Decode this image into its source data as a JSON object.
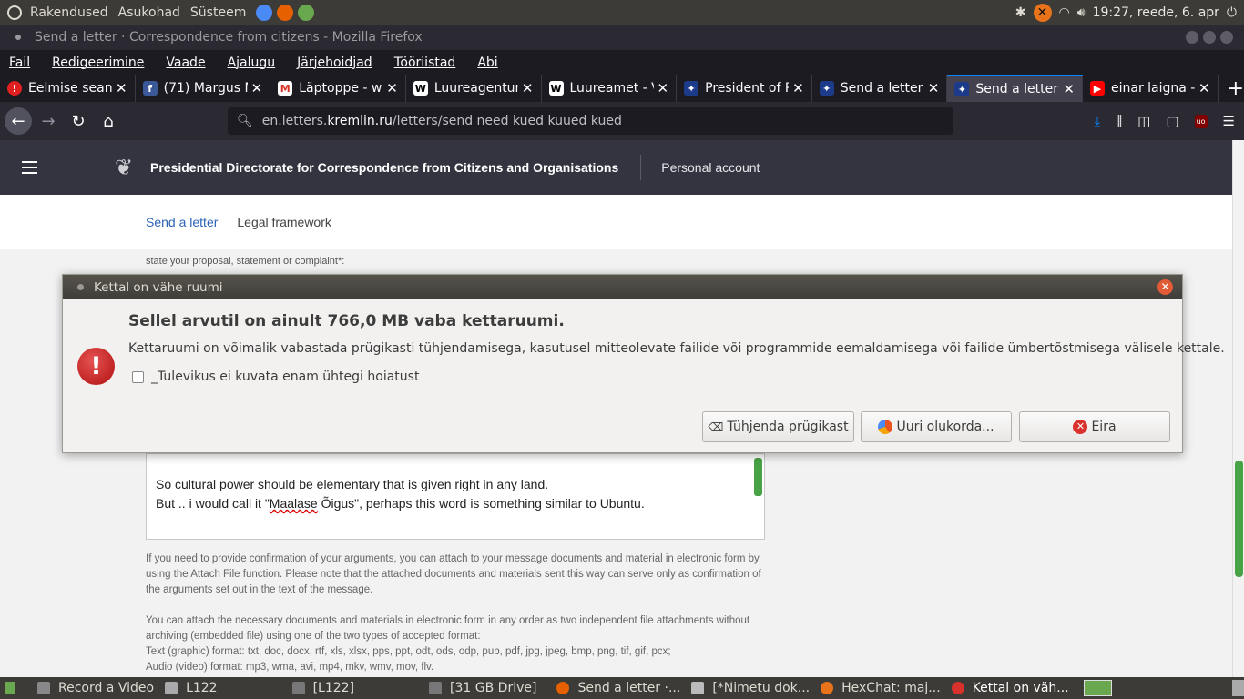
{
  "top_panel": {
    "menus": [
      "Rakendused",
      "Asukohad",
      "Süsteem"
    ],
    "clock": "19:27, reede,  6. apr"
  },
  "window_title": "Send a letter · Correspondence from citizens - Mozilla Firefox",
  "menubar": [
    "Fail",
    "Redigeerimine",
    "Vaade",
    "Ajalugu",
    "Järjehoidjad",
    "Tööriistad",
    "Abi"
  ],
  "tabs": [
    {
      "label": "Eelmise seans",
      "icon": "alert-icon",
      "icon_color": "#e02020"
    },
    {
      "label": "(71) Margus M",
      "icon": "facebook-icon",
      "icon_color": "#3b5998"
    },
    {
      "label": "Läptoppe - w",
      "icon": "gmail-icon",
      "icon_color": "#d93025"
    },
    {
      "label": "Luureagentur",
      "icon": "wikipedia-icon",
      "icon_color": "#ffffff"
    },
    {
      "label": "Luureamet - V",
      "icon": "wikipedia-icon",
      "icon_color": "#ffffff"
    },
    {
      "label": "President of R",
      "icon": "kremlin-icon",
      "icon_color": "#1d3b8b"
    },
    {
      "label": "Send a letter",
      "icon": "kremlin-icon",
      "icon_color": "#1d3b8b"
    },
    {
      "label": "Send a letter",
      "icon": "kremlin-icon",
      "icon_color": "#1d3b8b",
      "active": true
    },
    {
      "label": "einar laigna -",
      "icon": "youtube-icon",
      "icon_color": "#ff0000"
    }
  ],
  "url": {
    "prefix": "en.letters.",
    "host": "kremlin.ru",
    "path": "/letters/send  need kued kuued kued"
  },
  "site": {
    "title": "Presidential Directorate for Correspondence from Citizens and Organisations",
    "account": "Personal account",
    "nav_active": "Send a letter",
    "nav_link": "Legal framework",
    "prompt": "state your proposal, statement or complaint*:",
    "letter_line1": "So cultural power should be elementary that is given right in any land.",
    "letter_line2_a": "But .. i would call it \"",
    "letter_line2_misspelled": "Maalase",
    "letter_line2_b": " Õigus\", perhaps this word is something similar to Ubuntu.",
    "help1": "If you need to provide confirmation of your arguments, you can attach to your message documents and material in electronic form by using the Attach File function. Please note that the attached documents and materials sent this way can serve only as confirmation of the arguments set out in the text of the message.",
    "help2_l1": "You can attach the necessary documents and materials in electronic form in any order as two independent file attachments without archiving (embedded file) using one of the two types of accepted format:",
    "help2_l2": "Text (graphic) format: txt, doc, docx, rtf, xls, xlsx, pps, ppt, odt, ods, odp, pub, pdf, jpg, jpeg, bmp, png, tif, gif, pcx;",
    "help2_l3": "Audio (video) format: mp3, wma, avi, mp4, mkv, wmv, mov, flv."
  },
  "dialog": {
    "title": "Kettal on vähe ruumi",
    "headline": "Sellel arvutil on ainult 766,0 MB vaba kettaruumi.",
    "body": "Kettaruumi on võimalik vabastada prügikasti tühjendamisega, kasutusel mitteolevate failide või programmide eemaldamisega või failide ümbertõstmisega välisele kettale.",
    "checkbox": "_Tulevikus ei kuvata enam ühtegi hoiatust",
    "btn_empty": "Tühjenda prügikast",
    "btn_examine": "Uuri olukorda...",
    "btn_ignore": "Eira"
  },
  "taskbar": [
    {
      "label": "Record a Video"
    },
    {
      "label": "L122"
    },
    {
      "label": "[L122]"
    },
    {
      "label": "[31 GB Drive]"
    },
    {
      "label": "Send a letter ·..."
    },
    {
      "label": "[*Nimetu dok..."
    },
    {
      "label": "HexChat: maj..."
    },
    {
      "label": "Kettal on väh...",
      "active": true
    }
  ]
}
